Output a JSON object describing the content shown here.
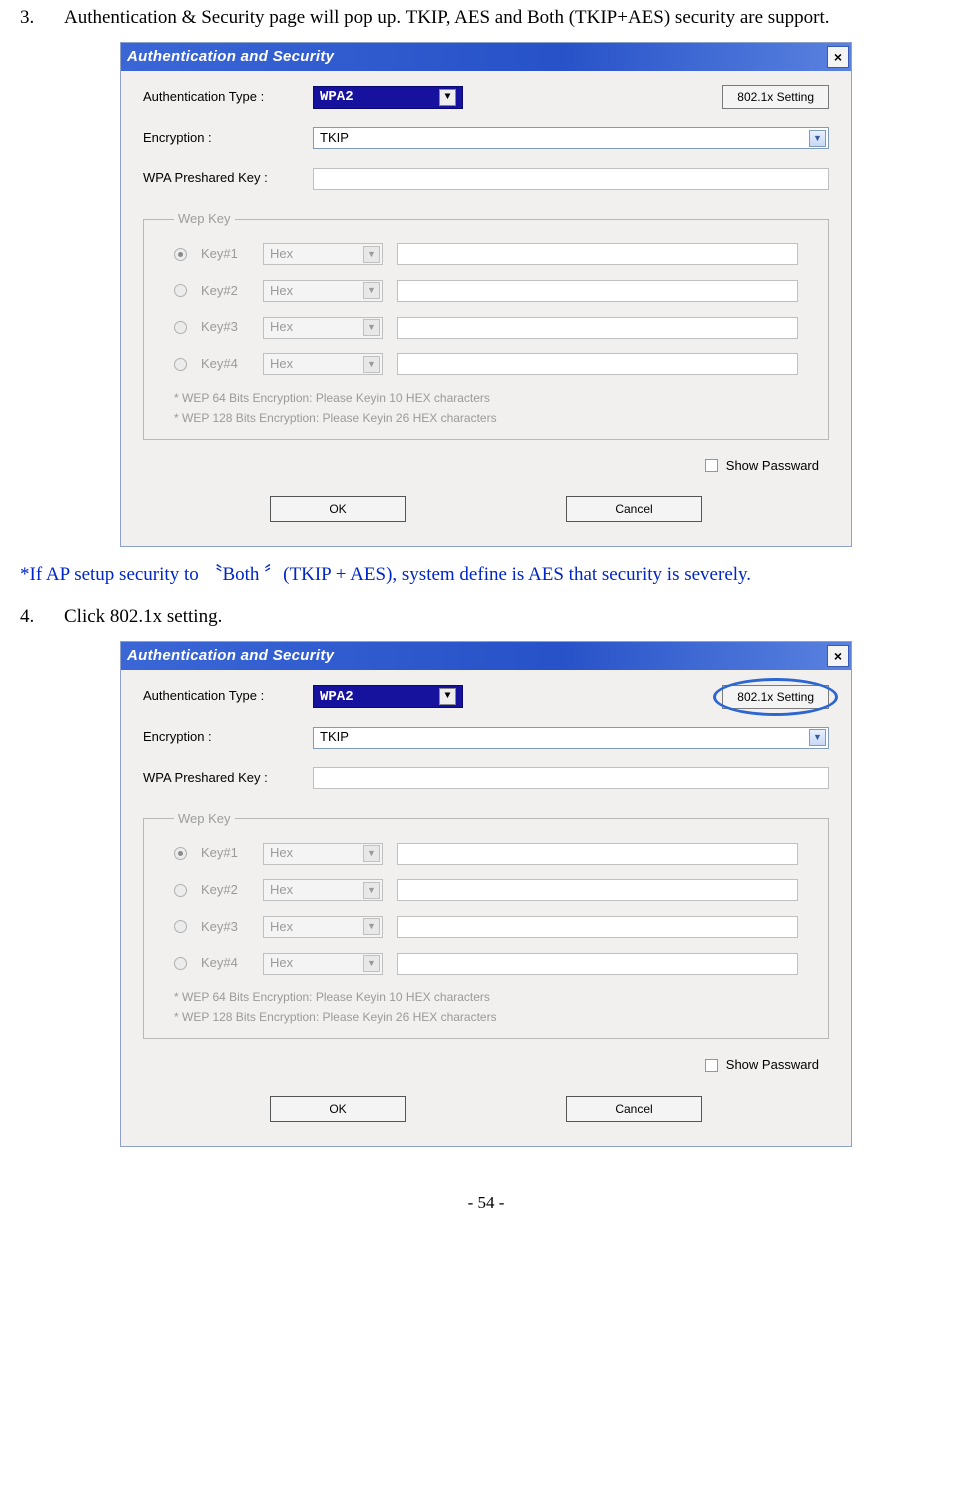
{
  "steps": {
    "s3": {
      "num": "3.",
      "text": "Authentication & Security page will pop up. TKIP, AES and Both (TKIP+AES) security are support."
    },
    "note": "*If AP setup security to 〝Both 〞(TKIP + AES), system define is AES that security is severely.",
    "s4": {
      "num": "4.",
      "text": "Click 802.1x setting."
    }
  },
  "dialog": {
    "title": "Authentication and Security",
    "labels": {
      "authtype": "Authentication Type :",
      "encryption": "Encryption :",
      "psk": "WPA Preshared Key :"
    },
    "authtype_value": "WPA2",
    "btn_8021x": "802.1x Setting",
    "encryption_value": "TKIP",
    "psk_value": "",
    "wep": {
      "legend": "Wep Key",
      "keys": [
        "Key#1",
        "Key#2",
        "Key#3",
        "Key#4"
      ],
      "fmt": "Hex",
      "hint1": "* WEP 64 Bits Encryption:   Please Keyin 10 HEX characters",
      "hint2": "* WEP 128 Bits Encryption:  Please Keyin 26 HEX characters"
    },
    "showpw": "Show Passward",
    "ok": "OK",
    "cancel": "Cancel"
  },
  "footer": "- 54 -"
}
